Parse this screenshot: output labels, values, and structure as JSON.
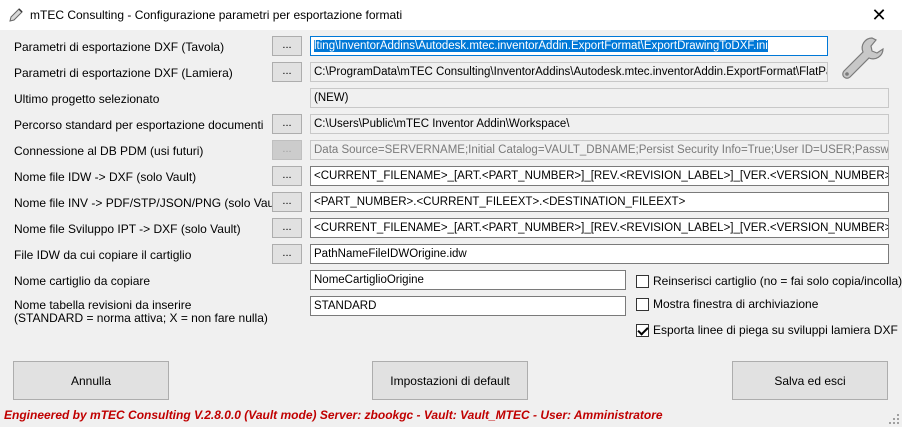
{
  "window": {
    "title": "mTEC Consulting - Configurazione parametri per esportazione formati",
    "close_symbol": "✕"
  },
  "icons": {
    "app": "pen-nib-icon",
    "settings": "wrench-icon",
    "close": "close-icon"
  },
  "rows": [
    {
      "label": "Parametri di esportazione DXF (Tavola)",
      "button": "...",
      "value": "lting\\InventorAddins\\Autodesk.mtec.inventorAddin.ExportFormat\\ExportDrawingToDXF.ini"
    },
    {
      "label": "Parametri di esportazione DXF (Lamiera)",
      "button": "...",
      "value": "C:\\ProgramData\\mTEC Consulting\\InventorAddins\\Autodesk.mtec.inventorAddin.ExportFormat\\FlatPatternPo"
    },
    {
      "label": "Ultimo progetto selezionato",
      "value": "(NEW)"
    },
    {
      "label": "Percorso standard per esportazione documenti",
      "button": "...",
      "value": "C:\\Users\\Public\\mTEC Inventor Addin\\Workspace\\"
    },
    {
      "label": "Connessione al DB PDM (usi futuri)",
      "button": "...",
      "value": "Data Source=SERVERNAME;Initial Catalog=VAULT_DBNAME;Persist Security Info=True;User ID=USER;Password=PAS"
    },
    {
      "label": "Nome file IDW -> DXF (solo Vault)",
      "button": "...",
      "value": "<CURRENT_FILENAME>_[ART.<PART_NUMBER>]_[REV.<REVISION_LABEL>]_[VER.<VERSION_NUMBER>]_[<LIF"
    },
    {
      "label": "Nome file INV -> PDF/STP/JSON/PNG (solo Vault)",
      "button": "...",
      "value": "<PART_NUMBER>.<CURRENT_FILEEXT>.<DESTINATION_FILEEXT>"
    },
    {
      "label": "Nome file Sviluppo IPT -> DXF (solo Vault)",
      "button": "...",
      "value": "<CURRENT_FILENAME>_[ART.<PART_NUMBER>]_[REV.<REVISION_LABEL>]_[VER.<VERSION_NUMBER>]_[<LIF"
    },
    {
      "label": "File IDW da cui copiare il cartiglio",
      "button": "...",
      "value": "PathNameFileIDWOrigine.idw"
    },
    {
      "label": "Nome cartiglio da copiare",
      "value": "NomeCartiglioOrigine"
    },
    {
      "label": "Nome tabella revisioni da inserire",
      "label2": "(STANDARD = norma attiva; X = non fare nulla)",
      "value": "STANDARD"
    }
  ],
  "checkboxes": [
    {
      "label": "Reinserisci cartiglio (no = fai solo copia/incolla)",
      "checked": false
    },
    {
      "label": "Mostra finestra di archiviazione",
      "checked": false
    },
    {
      "label": "Esporta linee di piega su sviluppi lamiera DXF",
      "checked": true
    }
  ],
  "buttons": {
    "cancel": "Annulla",
    "defaults": "Impostazioni di default",
    "save": "Salva ed esci"
  },
  "status_bar": "Engineered by mTEC Consulting V.2.8.0.0 (Vault mode) Server: zbookgc - Vault: Vault_MTEC - User: Amministratore",
  "colors": {
    "status_text": "#c00000",
    "selection": "#0078d7",
    "window_bg": "#f0f0f0"
  }
}
